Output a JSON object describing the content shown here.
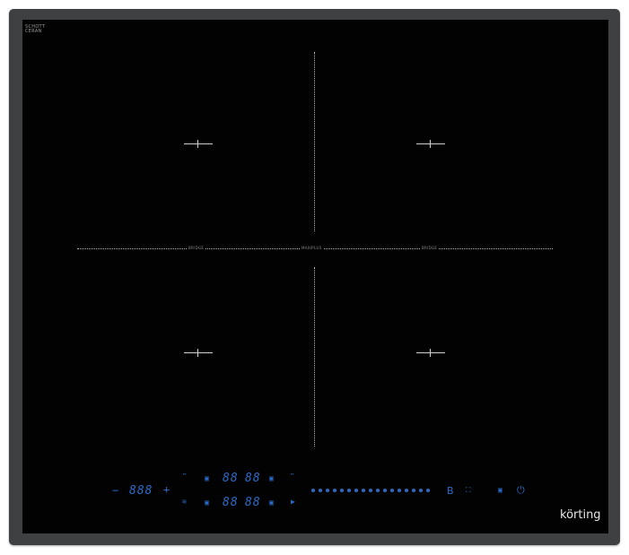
{
  "brand_top": [
    "SCHOTT",
    "CERAN"
  ],
  "zone_labels": {
    "bridge_left": "BRIDGE",
    "maxiplus": "MAXIPLUS",
    "bridge_right": "BRIDGE"
  },
  "controls": {
    "minus": "−",
    "timer_display": "888",
    "plus": "+",
    "zone_displays": [
      "88",
      "88",
      "88",
      "88"
    ],
    "steam_icon": "≋",
    "play_icon": "▶",
    "boost": "B",
    "slider_dots": 17
  },
  "logo": "körting",
  "colors": {
    "glass": "#020203",
    "frame": "#3f4042",
    "touch_blue": "#2a6cc8"
  }
}
